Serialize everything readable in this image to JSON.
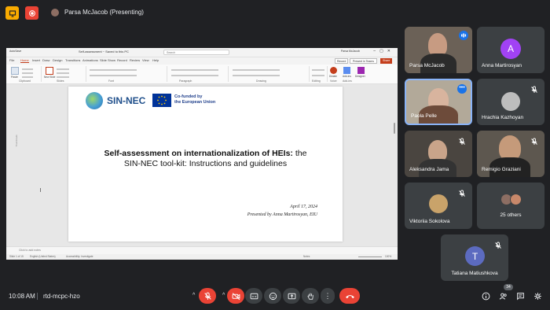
{
  "topbar": {
    "presenting_text": "Parsa McJacob (Presenting)"
  },
  "ppt": {
    "autosave": "AutoSave",
    "doc_title": "Self-assessment ~ Saved to this PC",
    "search_placeholder": "Search",
    "user": "Parsa McJacob",
    "menu": [
      "File",
      "Home",
      "Insert",
      "Draw",
      "Design",
      "Transitions",
      "Animations",
      "Slide Show",
      "Record",
      "Review",
      "View",
      "Help"
    ],
    "present_label": "Present in Teams",
    "share_label": "Share",
    "record_label": "Record",
    "ribbon_groups": [
      "Clipboard",
      "Slides",
      "Font",
      "Paragraph",
      "Drawing",
      "Editing",
      "Voice",
      "Add-ins"
    ],
    "ribbon_buttons": {
      "paste": "Paste",
      "new_slide": "New Slide",
      "dictate": "Dictate",
      "addins": "Add-ins",
      "designer": "Designer"
    },
    "thumbnails_label": "Thumbnails",
    "notes_placeholder": "Click to add notes",
    "status": {
      "slide": "Slide 1 of 15",
      "lang": "English (United States)",
      "accessibility": "Accessibility: Investigate",
      "notes": "Notes",
      "zoom": "100%"
    }
  },
  "slide": {
    "logo_text": "SIN-NEC",
    "eu_text_line1": "Co-funded by",
    "eu_text_line2": "the European Union",
    "title_bold": "Self-assessment on internationalization of HEIs:",
    "title_rest": " the",
    "title_line2": "SIN-NEC tool-kit: Instructions and guidelines",
    "date": "April 17, 2024",
    "presenter": "Presented by Anna Martirosyan, EIU"
  },
  "participants": {
    "p1": "Parsa McJacob",
    "p2": "Anna Martirosyan",
    "p2_initial": "A",
    "p3": "Paola Pelle",
    "p4": "Hrachia Kazhoyan",
    "p5": "Aleksandra Jama",
    "p6": "Remigio Graziani",
    "p7": "Viktoriia Sokolova",
    "p8": "25 others",
    "p9": "Tatiana Matiushkova",
    "p9_initial": "T"
  },
  "bottom": {
    "time": "10:08 AM",
    "meeting_code": "rtd-mcpc-hzo",
    "people_count": "34"
  },
  "colors": {
    "background": "#202124",
    "tile": "#3c4043",
    "accent_blue": "#1a73e8",
    "red": "#ea4335"
  }
}
